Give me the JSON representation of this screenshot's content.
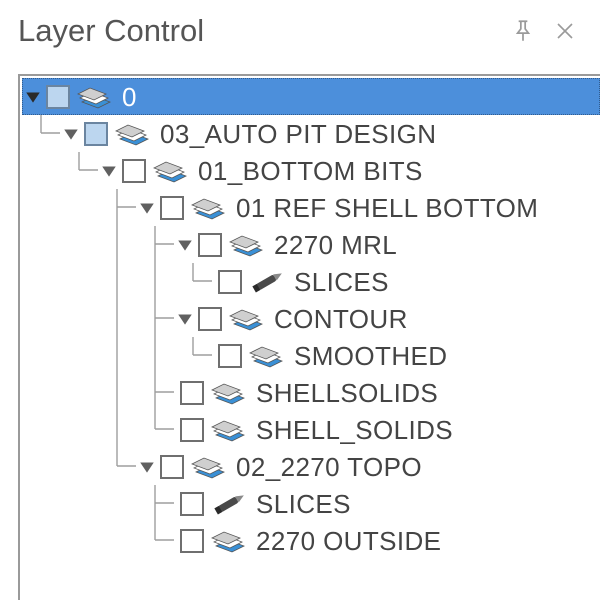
{
  "window": {
    "title": "Layer Control"
  },
  "icons": {
    "layers": "layers-icon",
    "pen": "pen-icon"
  },
  "tree": {
    "root": {
      "label": "0",
      "checked": "tri",
      "icon": "layers",
      "expanded": true,
      "selected": true,
      "children": [
        {
          "label": "03_AUTO PIT DESIGN",
          "checked": "tri",
          "icon": "layers",
          "expanded": true,
          "children": [
            {
              "label": "01_BOTTOM BITS",
              "checked": "off",
              "icon": "layers",
              "expanded": true,
              "children": [
                {
                  "label": "01 REF SHELL BOTTOM",
                  "checked": "off",
                  "icon": "layers",
                  "expanded": true,
                  "children": [
                    {
                      "label": "2270 MRL",
                      "checked": "off",
                      "icon": "layers",
                      "expanded": true,
                      "children": [
                        {
                          "label": "SLICES",
                          "checked": "off",
                          "icon": "pen"
                        }
                      ]
                    },
                    {
                      "label": "CONTOUR",
                      "checked": "off",
                      "icon": "layers",
                      "expanded": true,
                      "children": [
                        {
                          "label": "SMOOTHED",
                          "checked": "off",
                          "icon": "layers"
                        }
                      ]
                    },
                    {
                      "label": "SHELLSOLIDS",
                      "checked": "off",
                      "icon": "layers"
                    },
                    {
                      "label": "SHELL_SOLIDS",
                      "checked": "off",
                      "icon": "layers"
                    }
                  ]
                },
                {
                  "label": "02_2270 TOPO",
                  "checked": "off",
                  "icon": "layers",
                  "expanded": true,
                  "children": [
                    {
                      "label": "SLICES",
                      "checked": "off",
                      "icon": "pen"
                    },
                    {
                      "label": "2270 OUTSIDE",
                      "checked": "off",
                      "icon": "layers"
                    }
                  ]
                }
              ]
            }
          ]
        }
      ]
    }
  }
}
